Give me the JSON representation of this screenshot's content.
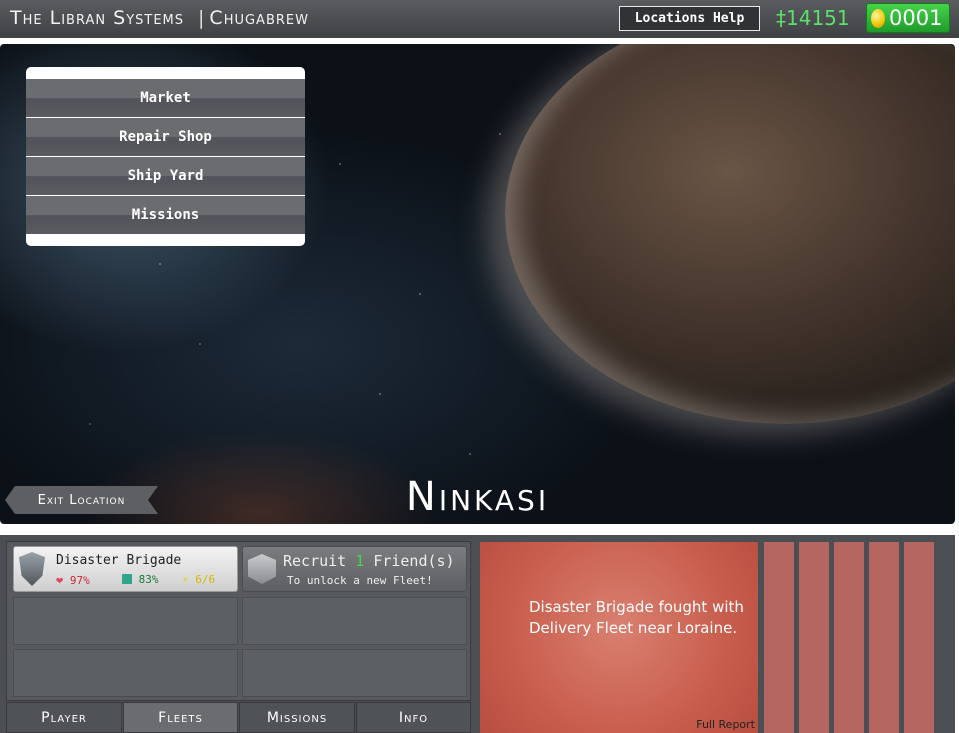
{
  "header": {
    "system_name": "The Libran Systems",
    "location_name": "Chugabrew",
    "help_button": "Locations Help",
    "credits": "‡14151",
    "gold": "0001"
  },
  "menu": {
    "items": [
      {
        "label": "Market"
      },
      {
        "label": "Repair Shop"
      },
      {
        "label": "Ship Yard"
      },
      {
        "label": "Missions"
      }
    ]
  },
  "scene": {
    "exit_button": "Exit Location",
    "planet_name": "Ninkasi"
  },
  "fleet": {
    "name": "Disaster Brigade",
    "health": "97%",
    "cargo": "83%",
    "energy": "6/6"
  },
  "recruit": {
    "prefix": "Recruit",
    "count": "1",
    "suffix": "Friend(s)",
    "subtitle": "To unlock a new Fleet!"
  },
  "tabs": [
    {
      "label": "Player"
    },
    {
      "label": "Fleets"
    },
    {
      "label": "Missions"
    },
    {
      "label": "Info"
    }
  ],
  "news": {
    "message": "Disaster Brigade fought with Delivery Fleet near Loraine.",
    "link": "Full Report"
  },
  "colors": {
    "credits": "#5be06a",
    "gold_button": "#2fb536",
    "news_bg": "#c95e4e"
  },
  "icons": [
    "coin-icon",
    "shield-icon",
    "heart-icon",
    "cube-icon",
    "bolt-icon",
    "recruit-icon"
  ]
}
